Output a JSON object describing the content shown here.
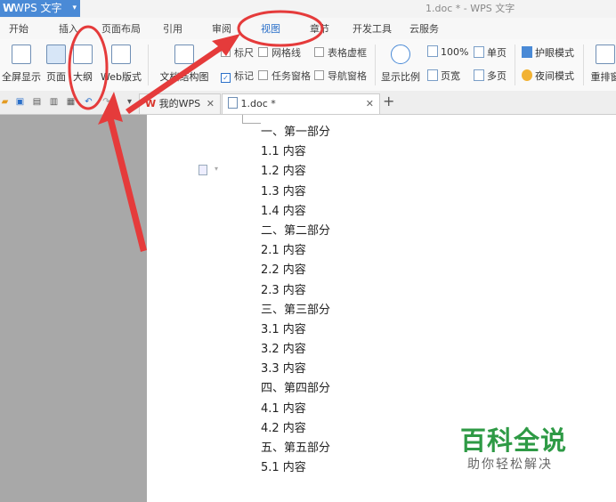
{
  "app": {
    "name": "WPS 文字",
    "doc_title": "1.doc * - WPS 文字"
  },
  "menu": [
    "开始",
    "插入",
    "页面布局",
    "引用",
    "审阅",
    "视图",
    "章节",
    "开发工具",
    "云服务"
  ],
  "ribbon": {
    "fullscreen": "全屏显示",
    "page": "页面",
    "outline": "大纲",
    "web": "Web版式",
    "doc_structure": "文档结构图",
    "ruler": "标尺",
    "gridlines": "网格线",
    "table_gridlines": "表格虚框",
    "markup": "标记",
    "task_pane": "任务窗格",
    "nav_pane": "导航窗格",
    "zoom": "显示比例",
    "zoom_100": "100%",
    "page_width": "页宽",
    "single_page": "单页",
    "multi_page": "多页",
    "eye_mode": "护眼模式",
    "night_mode": "夜间模式",
    "rearrange": "重排窗"
  },
  "tabs": {
    "mywps": "我的WPS",
    "doc": "1.doc *"
  },
  "outline": [
    "一、第一部分",
    "1.1 内容",
    "1.2 内容",
    "1.3 内容",
    "1.4 内容",
    "二、第二部分",
    "2.1 内容",
    "2.2 内容",
    "2.3 内容",
    "三、第三部分",
    "3.1 内容",
    "3.2 内容",
    "3.3 内容",
    "四、第四部分",
    "4.1 内容",
    "4.2 内容",
    "五、第五部分",
    "5.1 内容"
  ],
  "watermark": {
    "brand": "百科全说",
    "slogan": "助你轻松解决"
  },
  "colors": {
    "accent": "#2a6fc9",
    "annotation": "#e53b3b",
    "watermark": "#2e9a45"
  }
}
